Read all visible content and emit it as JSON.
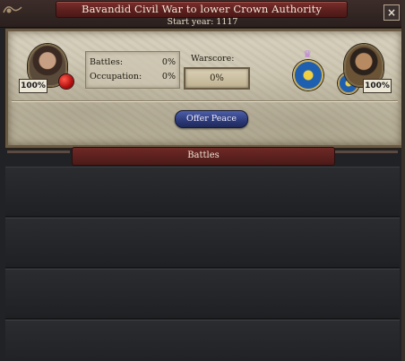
{
  "window": {
    "title": "Bavandid Civil War to lower Crown Authority",
    "start_year": "Start year: 1117",
    "close_label": "×"
  },
  "attacker": {
    "warscore_contribution": "100%",
    "portrait_icon": "attacker-portrait",
    "seal_icon": "red-seal-icon",
    "coa_icon": "blue-eagle-coat-of-arms-icon",
    "crown_icon": "purple-crown-icon",
    "crown_glyph": "♛"
  },
  "defender": {
    "warscore_contribution": "100%",
    "portrait_icon": "defender-portrait",
    "coa_icon": "blue-eagle-coat-of-arms-icon"
  },
  "stats": {
    "battles_label": "Battles:",
    "battles_value": "0%",
    "occupation_label": "Occupation:",
    "occupation_value": "0%"
  },
  "warscore": {
    "label": "Warscore:",
    "value": "0%"
  },
  "offer_peace_label": "Offer Peace",
  "battles_section": {
    "header": "Battles",
    "rows": [
      "",
      "",
      "",
      ""
    ]
  },
  "colors": {
    "title_scroll": "#5b1f1d",
    "parchment": "#c7c0aa",
    "offer_peace_button": "#2c3a78",
    "list_row": "#222428"
  }
}
